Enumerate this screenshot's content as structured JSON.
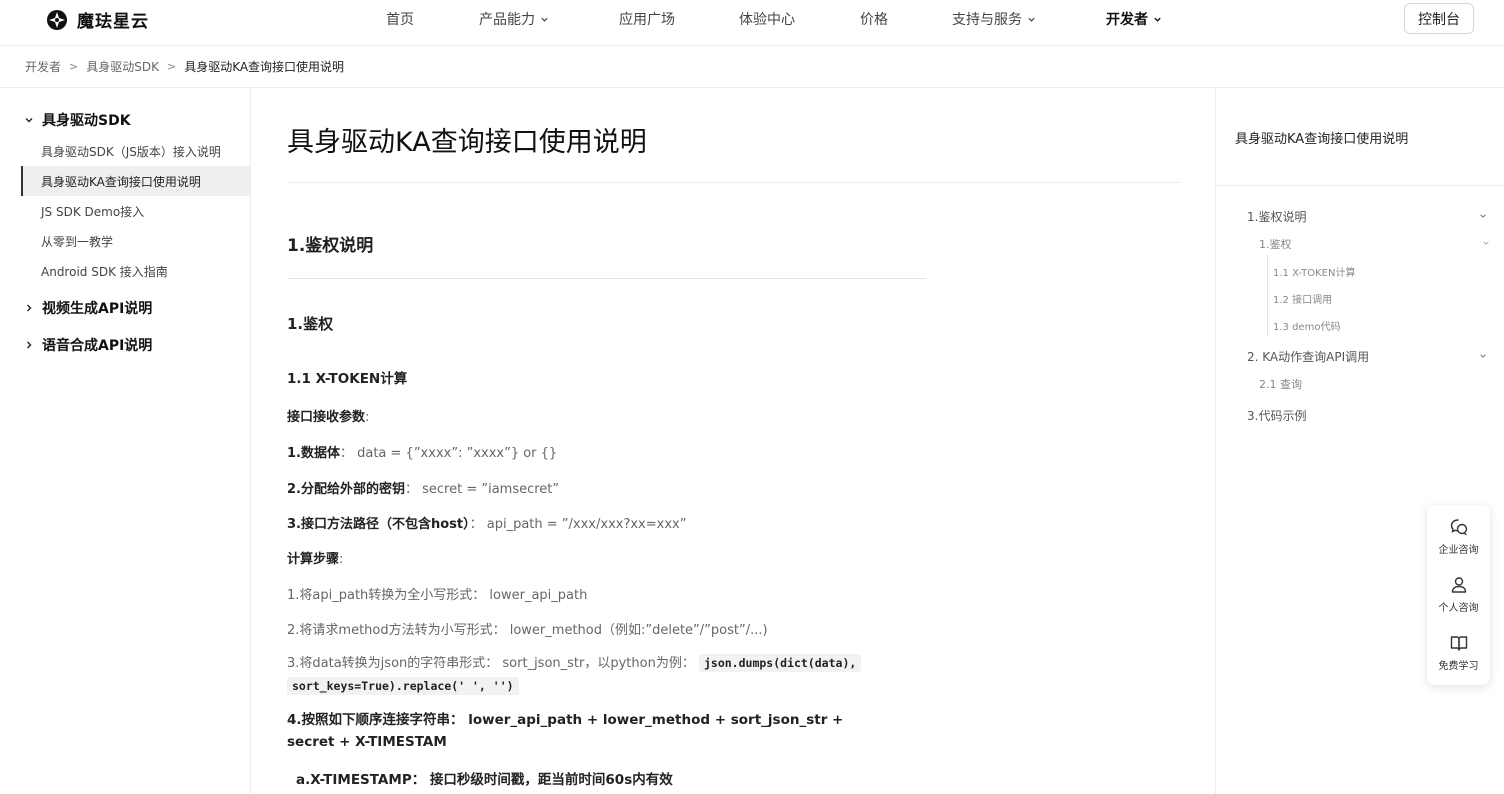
{
  "header": {
    "brand": "魔珐星云",
    "nav": [
      {
        "label": "首页",
        "dropdown": false
      },
      {
        "label": "产品能力",
        "dropdown": true
      },
      {
        "label": "应用广场",
        "dropdown": false
      },
      {
        "label": "体验中心",
        "dropdown": false
      },
      {
        "label": "价格",
        "dropdown": false
      },
      {
        "label": "支持与服务",
        "dropdown": true
      },
      {
        "label": "开发者",
        "dropdown": true,
        "active": true
      }
    ],
    "console_label": "控制台"
  },
  "breadcrumb": [
    "开发者",
    "具身驱动SDK",
    "具身驱动KA查询接口使用说明"
  ],
  "sidebar": {
    "groups": [
      {
        "label": "具身驱动SDK",
        "expanded": true,
        "items": [
          {
            "label": "具身驱动SDK（JS版本）接入说明"
          },
          {
            "label": "具身驱动KA查询接口使用说明",
            "active": true
          },
          {
            "label": "JS SDK Demo接入"
          },
          {
            "label": "从零到一教学"
          },
          {
            "label": "Android SDK 接入指南"
          }
        ]
      },
      {
        "label": "视频生成API说明",
        "expanded": false
      },
      {
        "label": "语音合成API说明",
        "expanded": false
      }
    ]
  },
  "content": {
    "title": "具身驱动KA查询接口使用说明",
    "h2": "1.鉴权说明",
    "h3": "1.鉴权",
    "h4": "1.1 X-TOKEN计算",
    "recv_params": "接口接收参数",
    "recv_params_colon": ":",
    "p1_label": "1.数据体",
    "p1_text": "：  data = {”xxxx”: ”xxxx”} or {}",
    "p2_label": "2.分配给外部的密钥",
    "p2_text": "：  secret = ”iamsecret”",
    "p3_label": "3.接口方法路径（不包含host）",
    "p3_text": "：  api_path = ”/xxx/xxx?xx=xxx”",
    "calc_steps": "计算步骤",
    "calc_steps_colon": ":",
    "s1": "1.将api_path转换为全小写形式：  lower_api_path",
    "s2": "2.将请求method方法转为小写形式：  lower_method（例如:”delete”/”post”/...)",
    "s3_text": "3.将data转换为json的字符串形式：  sort_json_str，以python为例：",
    "s3_code1": "json.dumps(dict(data),",
    "s3_code2": "sort_keys=True).replace(' ', '')",
    "s4": "4.按照如下顺序连接字符串：  lower_api_path + lower_method + sort_json_str + secret + X-TIMESTAM",
    "s5": "a.X-TIMESTAMP：  接口秒级时间戳，距当前时间60s内有效"
  },
  "toc": {
    "title": "具身驱动KA查询接口使用说明",
    "items": [
      {
        "label": "1.鉴权说明",
        "level": 1
      },
      {
        "label": "1.鉴权",
        "level": 2
      },
      {
        "label": "1.1 X-TOKEN计算",
        "level": 3
      },
      {
        "label": "1.2 接口调用",
        "level": 3
      },
      {
        "label": "1.3 demo代码",
        "level": 3
      },
      {
        "label": "2. KA动作查询API调用",
        "level": 1
      },
      {
        "label": "2.1 查询",
        "level": 2
      },
      {
        "label": "3.代码示例",
        "level": 1
      }
    ]
  },
  "float_panel": [
    {
      "label": "企业咨询",
      "icon": "chat-icon"
    },
    {
      "label": "个人咨询",
      "icon": "user-icon"
    },
    {
      "label": "免费学习",
      "icon": "book-icon"
    }
  ]
}
